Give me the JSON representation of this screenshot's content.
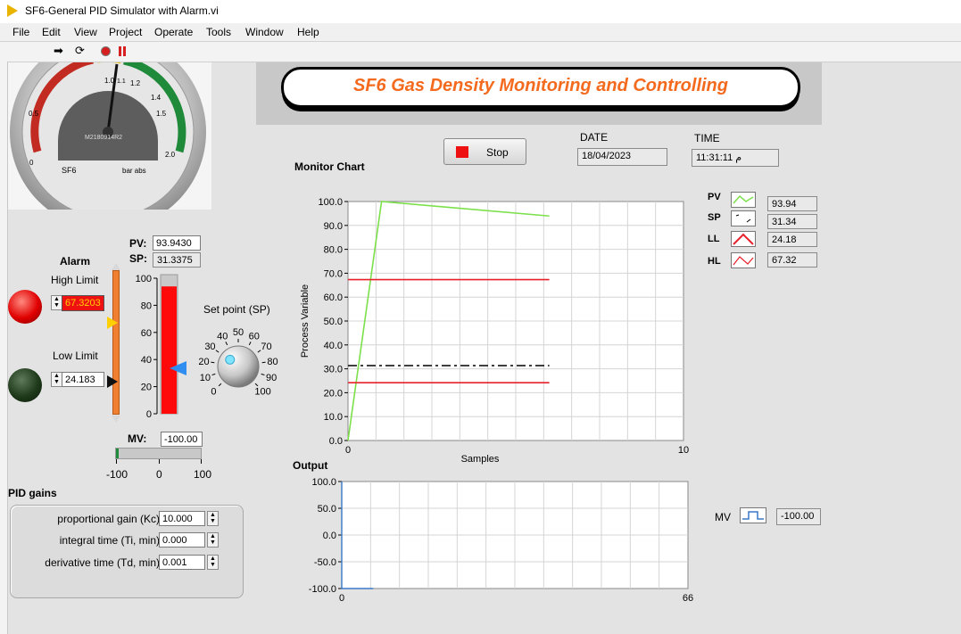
{
  "window": {
    "title": "SF6-General PID Simulator with Alarm.vi"
  },
  "menu": [
    "File",
    "Edit",
    "View",
    "Project",
    "Operate",
    "Tools",
    "Window",
    "Help"
  ],
  "banner": {
    "title": "SF6 Gas Density Monitoring and Controlling"
  },
  "gauge": {
    "scale": [
      "0",
      "0.5",
      "1.0",
      "1.1",
      "1.2",
      "1.4",
      "1.5",
      "2.0"
    ],
    "serial": "M2180914R2",
    "brand": "SF6",
    "unit": "bar abs"
  },
  "stop_button": {
    "label": "Stop"
  },
  "date": {
    "label": "DATE",
    "value": "18/04/2023"
  },
  "time": {
    "label": "TIME",
    "value": "11:31:11 م"
  },
  "alarm": {
    "title": "Alarm",
    "high_label": "High Limit",
    "high_value": "67.3203",
    "low_label": "Low Limit",
    "low_value": "24.183",
    "high_led_on": true,
    "low_led_on": false
  },
  "pv_sp": {
    "pv_label": "PV:",
    "pv_value": "93.9430",
    "sp_label": "SP:",
    "sp_value": "31.3375"
  },
  "tank": {
    "ticks": [
      "100",
      "80",
      "60",
      "40",
      "20",
      "0"
    ],
    "level": 93.94
  },
  "setpoint_knob": {
    "label": "Set point (SP)",
    "ticks": [
      "0",
      "10",
      "20",
      "30",
      "40",
      "50",
      "60",
      "70",
      "80",
      "90",
      "100"
    ],
    "value": 31.34
  },
  "mv": {
    "label": "MV:",
    "value": "-100.00",
    "ticks": [
      "-100",
      "0",
      "100"
    ],
    "level": -100
  },
  "pid": {
    "title": "PID gains",
    "kc_label": "proportional gain (Kc)",
    "kc_value": "10.000",
    "ti_label": "integral time (Ti, min)",
    "ti_value": "0.000",
    "td_label": "derivative time (Td, min)",
    "td_value": "0.001"
  },
  "legend": {
    "items": [
      {
        "name": "PV",
        "value": "93.94",
        "color": "#7be04a"
      },
      {
        "name": "SP",
        "value": "31.34",
        "color": "#000000"
      },
      {
        "name": "LL",
        "value": "24.18",
        "color": "#e8202a"
      },
      {
        "name": "HL",
        "value": "67.32",
        "color": "#e8202a"
      }
    ]
  },
  "mv_legend": {
    "name": "MV",
    "value": "-100.00",
    "color": "#3a78c8"
  },
  "chart_data": [
    {
      "type": "line",
      "title": "Monitor Chart",
      "xlabel": "Samples",
      "ylabel": "Process Variable",
      "xlim": [
        0,
        10
      ],
      "ylim": [
        0,
        100
      ],
      "x_tick_labels": [
        "0",
        "10"
      ],
      "y_tick_labels": [
        "0.0",
        "10.0",
        "20.0",
        "30.0",
        "40.0",
        "50.0",
        "60.0",
        "70.0",
        "80.0",
        "90.0",
        "100.0"
      ],
      "grid": true,
      "series": [
        {
          "name": "PV",
          "x": [
            0,
            1,
            6
          ],
          "y": [
            0,
            100,
            93.94
          ],
          "color": "#7be04a",
          "style": "solid"
        },
        {
          "name": "SP",
          "x": [
            0,
            6
          ],
          "y": [
            31.34,
            31.34
          ],
          "color": "#000000",
          "style": "dashdot"
        },
        {
          "name": "LL",
          "x": [
            0,
            6
          ],
          "y": [
            24.18,
            24.18
          ],
          "color": "#e8202a",
          "style": "solid"
        },
        {
          "name": "HL",
          "x": [
            0,
            6
          ],
          "y": [
            67.32,
            67.32
          ],
          "color": "#e8202a",
          "style": "solid"
        }
      ]
    },
    {
      "type": "line",
      "title": "Output",
      "xlabel": "",
      "ylabel": "",
      "xlim": [
        0,
        66
      ],
      "ylim": [
        -100,
        100
      ],
      "x_tick_labels": [
        "0",
        "66"
      ],
      "y_tick_labels": [
        "-100.0",
        "-50.0",
        "0.0",
        "50.0",
        "100.0"
      ],
      "grid": true,
      "series": [
        {
          "name": "MV",
          "x": [
            0,
            0,
            6
          ],
          "y": [
            100,
            -100,
            -100
          ],
          "color": "#3a78c8",
          "style": "solid"
        }
      ]
    }
  ]
}
